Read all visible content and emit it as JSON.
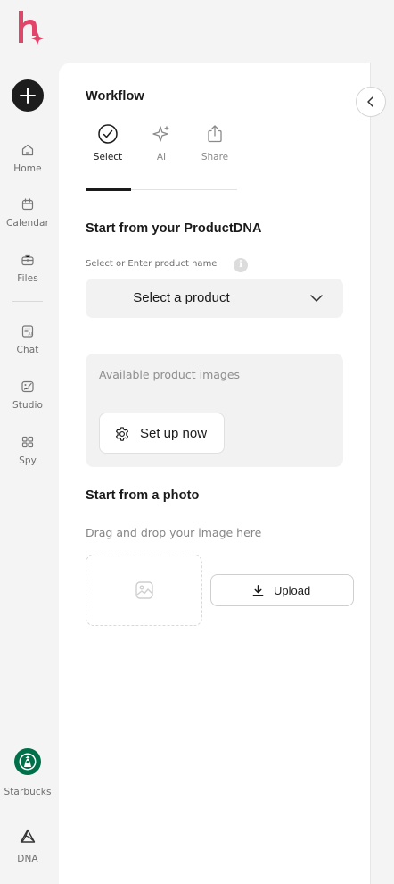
{
  "app": {
    "logo_icon": "h-logo-icon",
    "brand_color": "#e2456a"
  },
  "sidebar": {
    "new_button_icon": "plus-icon",
    "items": [
      {
        "label": "Home",
        "icon": "home-icon"
      },
      {
        "label": "Calendar",
        "icon": "calendar-icon"
      },
      {
        "label": "Files",
        "icon": "briefcase-icon"
      },
      {
        "label": "Chat",
        "icon": "chat-ai-icon"
      },
      {
        "label": "Studio",
        "icon": "studio-icon"
      },
      {
        "label": "Spy",
        "icon": "grid-icon"
      }
    ],
    "account": {
      "label": "Starbucks",
      "icon": "starbucks-logo"
    },
    "dna": {
      "label": "DNA",
      "icon": "dna-triangle-icon"
    }
  },
  "panel": {
    "title": "Workflow",
    "collapse_icon": "chevron-left-icon",
    "tabs": [
      {
        "label": "Select",
        "icon": "check-circle-icon",
        "active": true
      },
      {
        "label": "AI",
        "icon": "sparkles-icon",
        "active": false
      },
      {
        "label": "Share",
        "icon": "share-icon",
        "active": false
      }
    ],
    "product_section": {
      "title": "Start from your ProductDNA",
      "field_label": "Select or Enter product name",
      "info_icon": "i",
      "select_value": "Select a product",
      "images_label": "Available product images",
      "setup_button": "Set up now"
    },
    "photo_section": {
      "title": "Start from a photo",
      "drag_text": "Drag and drop your image here",
      "upload_button": "Upload"
    }
  }
}
